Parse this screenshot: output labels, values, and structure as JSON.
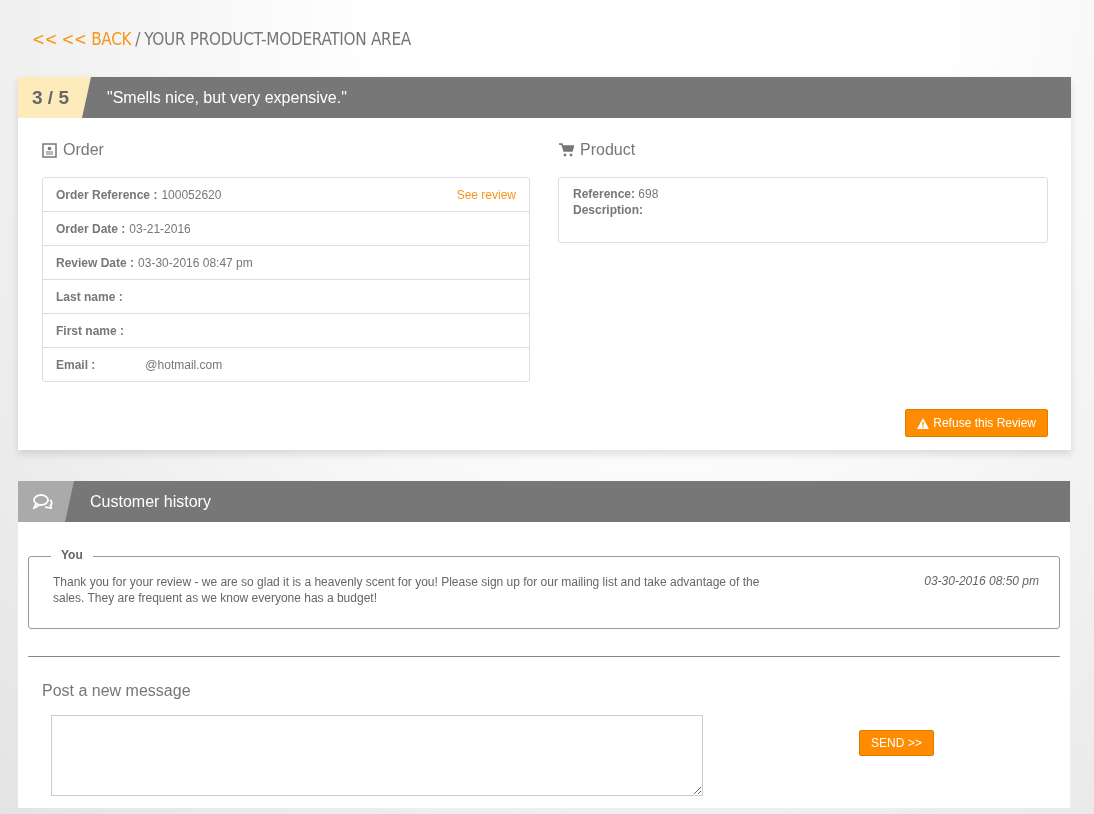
{
  "breadcrumb": {
    "back": "<< << BACK",
    "separator": "/",
    "title": "YOUR PRODUCT-MODERATION AREA"
  },
  "review": {
    "rating": "3 / 5",
    "title": "\"Smells nice, but very expensive.\""
  },
  "order": {
    "heading": "Order",
    "fields": [
      {
        "label": "Order Reference :",
        "value": "100052620",
        "link": "See review"
      },
      {
        "label": "Order Date :",
        "value": "03-21-2016"
      },
      {
        "label": "Review Date :",
        "value": "03-30-2016 08:47 pm"
      },
      {
        "label": "Last name :"
      },
      {
        "label": "First name :"
      },
      {
        "label": "Email :",
        "value": "@hotmail.com"
      }
    ]
  },
  "product": {
    "heading": "Product",
    "fields": [
      {
        "label": "Reference:",
        "value": "698"
      },
      {
        "label": "Description:"
      }
    ]
  },
  "refuse_button": "Refuse this Review",
  "history": {
    "title": "Customer history",
    "messages": [
      {
        "author": "You",
        "text": "Thank you for your review - we are so glad it is a heavenly scent for you! Please sign up for our mailing list and take advantage of the sales. They are frequent as we know everyone has a budget!",
        "date": "03-30-2016 08:50 pm"
      }
    ]
  },
  "new_message": {
    "label": "Post a new message",
    "send": "SEND >>"
  }
}
